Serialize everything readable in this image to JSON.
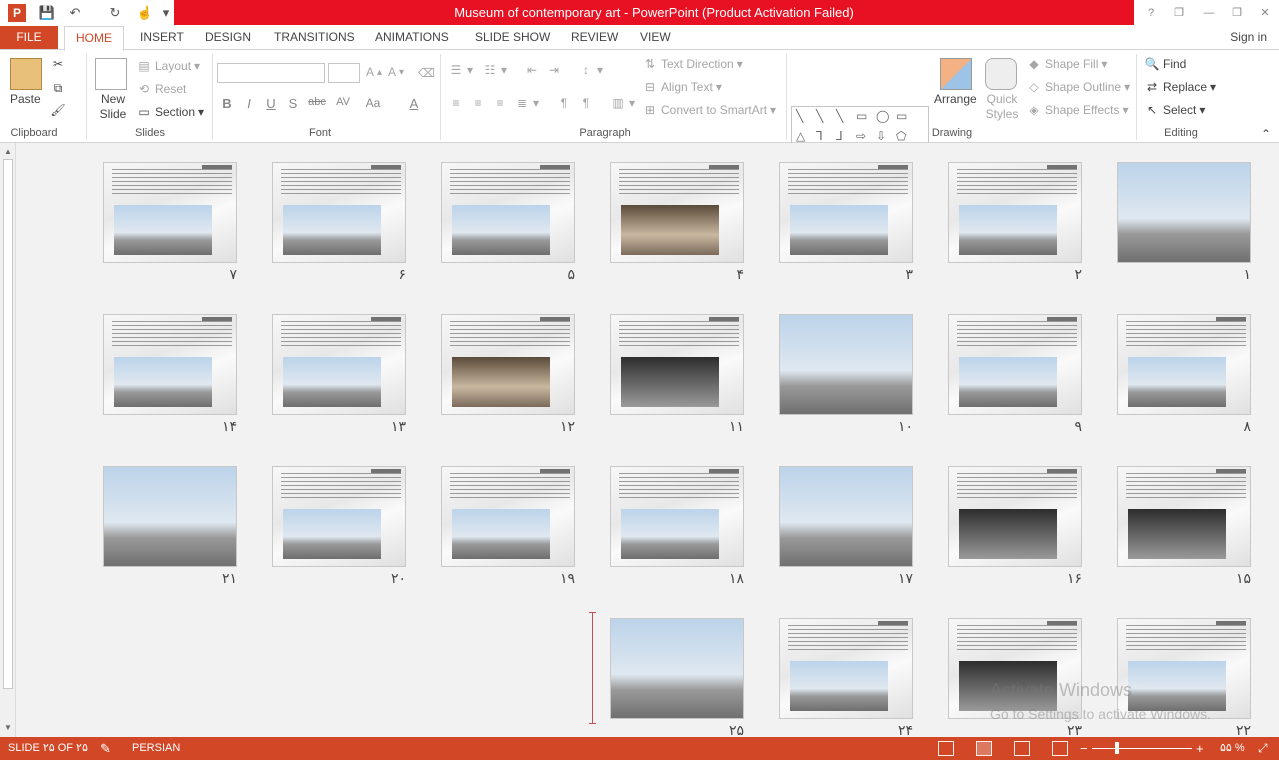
{
  "window": {
    "title": "Museum of contemporary art -  PowerPoint (Product Activation Failed)",
    "help": "?",
    "controls": {
      "restore_ribbon": "❐",
      "minimize": "—",
      "maximize": "❐",
      "close": "✕"
    }
  },
  "quick_access": {
    "save": "💾",
    "undo": "↶",
    "redo": "↻",
    "touch": "☝",
    "customize": "▾"
  },
  "tabs": [
    "FILE",
    "HOME",
    "INSERT",
    "DESIGN",
    "TRANSITIONS",
    "ANIMATIONS",
    "SLIDE SHOW",
    "REVIEW",
    "VIEW"
  ],
  "signin": "Sign in",
  "clipboard": {
    "label": "Clipboard",
    "paste": "Paste"
  },
  "slides_group": {
    "label": "Slides",
    "new_slide": "New Slide",
    "layout": "Layout",
    "reset": "Reset",
    "section": "Section"
  },
  "font": {
    "label": "Font",
    "bold": "B",
    "italic": "I",
    "underline": "U",
    "shadow": "S",
    "strike": "abc",
    "spacing": "AV",
    "case": "Aa",
    "color": "A",
    "grow": "A",
    "shrink": "A"
  },
  "paragraph": {
    "label": "Paragraph",
    "text_direction": "Text Direction",
    "align_text": "Align Text",
    "convert_smartart": "Convert to SmartArt"
  },
  "drawing": {
    "label": "Drawing",
    "arrange": "Arrange",
    "quick_styles": "Quick Styles",
    "shape_fill": "Shape Fill",
    "shape_outline": "Shape Outline",
    "shape_effects": "Shape Effects"
  },
  "editing": {
    "label": "Editing",
    "find": "Find",
    "replace": "Replace",
    "select": "Select"
  },
  "slides": [
    {
      "n": "۱",
      "style": "full"
    },
    {
      "n": "۲",
      "style": "plain"
    },
    {
      "n": "۳",
      "style": "plain"
    },
    {
      "n": "۴",
      "style": "warm"
    },
    {
      "n": "۵",
      "style": "plain"
    },
    {
      "n": "۶",
      "style": "plain"
    },
    {
      "n": "۷",
      "style": "plain"
    },
    {
      "n": "۸",
      "style": "plain"
    },
    {
      "n": "۹",
      "style": "plain"
    },
    {
      "n": "۱۰",
      "style": "full"
    },
    {
      "n": "۱۱",
      "style": "dark"
    },
    {
      "n": "۱۲",
      "style": "warm"
    },
    {
      "n": "۱۳",
      "style": "plain"
    },
    {
      "n": "۱۴",
      "style": "plain"
    },
    {
      "n": "۱۵",
      "style": "dark"
    },
    {
      "n": "۱۶",
      "style": "dark"
    },
    {
      "n": "۱۷",
      "style": "full"
    },
    {
      "n": "۱۸",
      "style": "plain"
    },
    {
      "n": "۱۹",
      "style": "plain"
    },
    {
      "n": "۲۰",
      "style": "plain"
    },
    {
      "n": "۲۱",
      "style": "full"
    },
    {
      "n": "۲۲",
      "style": "plain"
    },
    {
      "n": "۲۳",
      "style": "dark"
    },
    {
      "n": "۲۴",
      "style": "plain"
    },
    {
      "n": "۲۵",
      "style": "full"
    }
  ],
  "watermark": {
    "line1": "Activate Windows",
    "line2": "Go to Settings to activate Windows."
  },
  "status": {
    "slide": "SLIDE ۲۵ OF ۲۵",
    "language": "PERSIAN",
    "zoom": "۵۵ %"
  }
}
